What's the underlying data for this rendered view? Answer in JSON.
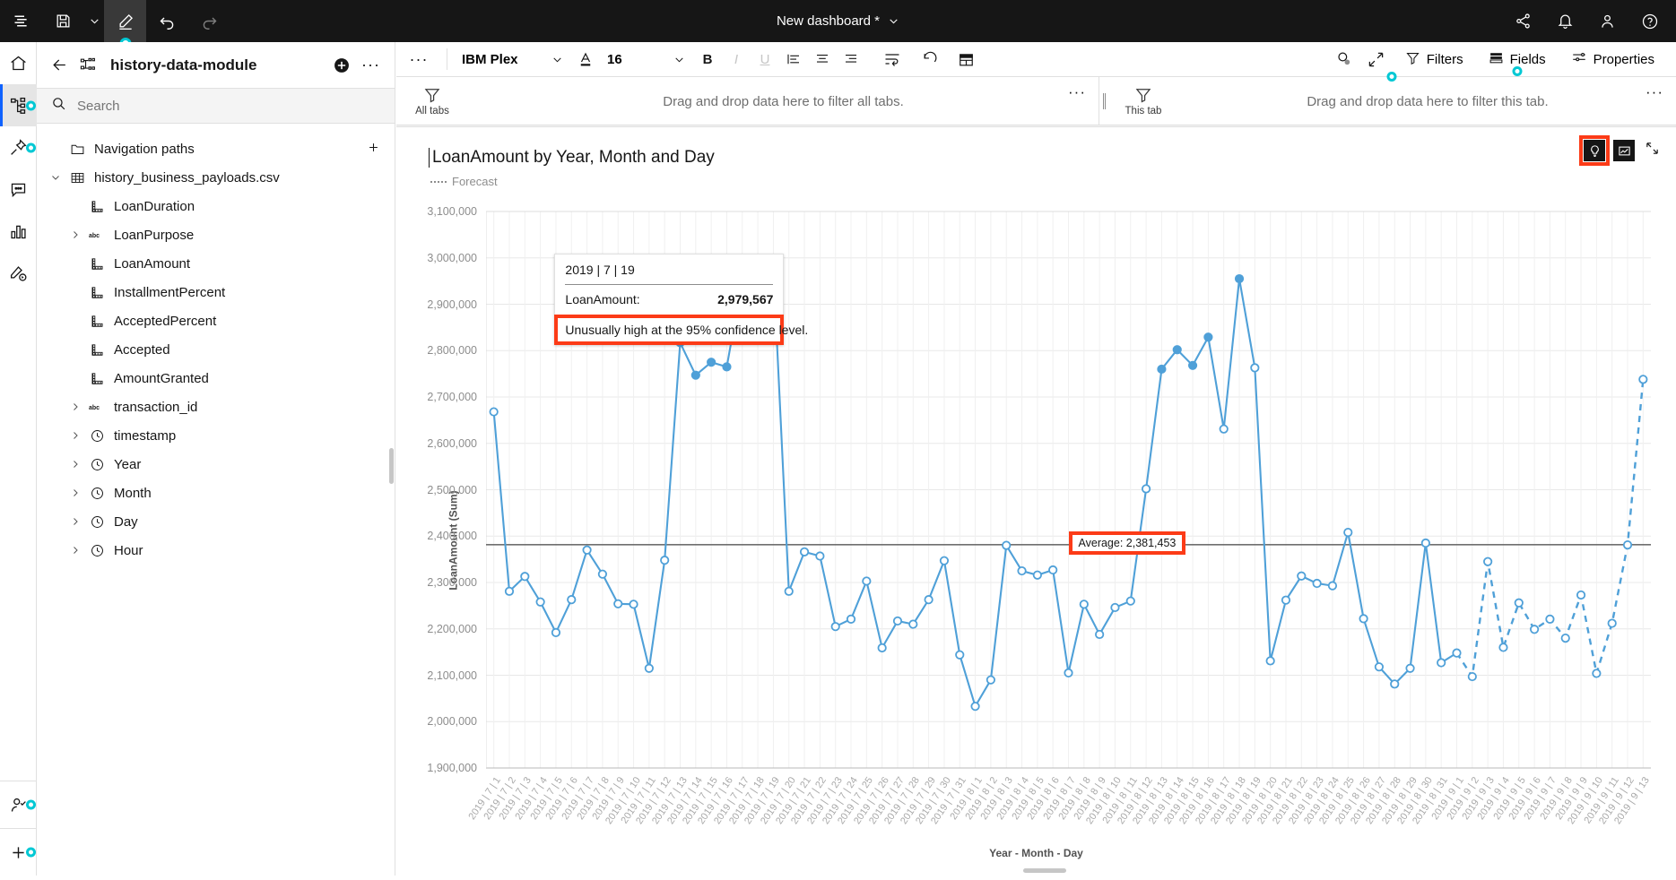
{
  "topbar": {
    "title": "New dashboard *",
    "left_icons": [
      {
        "name": "menu-list-icon",
        "label": "Show menu"
      },
      {
        "name": "save-icon",
        "label": "Save"
      },
      {
        "name": "save-caret-icon",
        "label": "Save options"
      },
      {
        "name": "edit-pencil-icon",
        "label": "Edit"
      },
      {
        "name": "undo-icon",
        "label": "Undo"
      },
      {
        "name": "redo-icon",
        "label": "Redo"
      }
    ],
    "right_icons": [
      {
        "name": "share-icon",
        "label": "Share"
      },
      {
        "name": "notification-bell-icon",
        "label": "Notifications"
      },
      {
        "name": "user-avatar-icon",
        "label": "Account"
      },
      {
        "name": "help-icon",
        "label": "Help"
      }
    ]
  },
  "rail": {
    "items": [
      {
        "name": "sidebar-item-home",
        "label": "Home",
        "dot": false
      },
      {
        "name": "sidebar-item-sources",
        "label": "Sources",
        "dot": true
      },
      {
        "name": "sidebar-item-pinned",
        "label": "Pinned",
        "dot": true
      },
      {
        "name": "sidebar-item-comments",
        "label": "Comments",
        "dot": false
      },
      {
        "name": "sidebar-item-visualizations",
        "label": "Visualizations",
        "dot": false
      },
      {
        "name": "sidebar-item-assistant",
        "label": "Assistant",
        "dot": false
      }
    ],
    "bottom": [
      {
        "name": "sidebar-item-user",
        "label": "User",
        "dot": true
      },
      {
        "name": "sidebar-item-add",
        "label": "Add",
        "dot": true
      }
    ]
  },
  "panel": {
    "title": "history-data-module",
    "add_label": "+",
    "overflow_label": "···",
    "search_placeholder": "Search",
    "search_value": "",
    "tree": [
      {
        "label": "Navigation paths",
        "icon": "folder-icon",
        "caret": "none",
        "indent": 1,
        "trailing": "plus-icon"
      },
      {
        "label": "history_business_payloads.csv",
        "icon": "table-icon",
        "caret": "down",
        "indent": 1
      },
      {
        "label": "LoanDuration",
        "icon": "measure-icon",
        "caret": "none",
        "indent": 2
      },
      {
        "label": "LoanPurpose",
        "icon": "abc-icon",
        "caret": "right",
        "indent": 2
      },
      {
        "label": "LoanAmount",
        "icon": "measure-icon",
        "caret": "none",
        "indent": 2
      },
      {
        "label": "InstallmentPercent",
        "icon": "measure-icon",
        "caret": "none",
        "indent": 2
      },
      {
        "label": "AcceptedPercent",
        "icon": "measure-icon",
        "caret": "none",
        "indent": 2
      },
      {
        "label": "Accepted",
        "icon": "measure-icon",
        "caret": "none",
        "indent": 2
      },
      {
        "label": "AmountGranted",
        "icon": "measure-icon",
        "caret": "none",
        "indent": 2
      },
      {
        "label": "transaction_id",
        "icon": "abc-icon",
        "caret": "right",
        "indent": 2
      },
      {
        "label": "timestamp",
        "icon": "clock-icon",
        "caret": "right",
        "indent": 2
      },
      {
        "label": "Year",
        "icon": "clock-icon",
        "caret": "right",
        "indent": 2
      },
      {
        "label": "Month",
        "icon": "clock-icon",
        "caret": "right",
        "indent": 2
      },
      {
        "label": "Day",
        "icon": "clock-icon",
        "caret": "right",
        "indent": 2
      },
      {
        "label": "Hour",
        "icon": "clock-icon",
        "caret": "right",
        "indent": 2
      }
    ]
  },
  "toolbar": {
    "more_label": "···",
    "font_name": "IBM Plex",
    "font_size": "16",
    "buttons": [
      {
        "name": "font-color-button",
        "label": "A"
      },
      {
        "name": "bold-button",
        "label": "B"
      },
      {
        "name": "italic-button",
        "label": "I"
      },
      {
        "name": "underline-button",
        "label": "U"
      }
    ],
    "right": [
      {
        "name": "tab-filters",
        "label": "Filters",
        "icon": "filter-icon",
        "active": false
      },
      {
        "name": "tab-fields",
        "label": "Fields",
        "icon": "fields-icon",
        "active": true
      },
      {
        "name": "tab-properties",
        "label": "Properties",
        "icon": "properties-icon",
        "active": false
      }
    ],
    "zoom_icon": "search-zoom-icon",
    "expand_icon": "expand-icon"
  },
  "filters": {
    "all_tabs": {
      "caption": "All tabs",
      "text": "Drag and drop data here to filter all tabs.",
      "more": "···"
    },
    "this_tab": {
      "caption": "This tab",
      "text": "Drag and drop data here to filter this tab.",
      "more": "···"
    }
  },
  "widget": {
    "title": "LoanAmount by Year, Month and Day",
    "legend": "Forecast",
    "actions": [
      {
        "name": "insights-lightbulb-button",
        "label": "Insights",
        "highlighted": true
      },
      {
        "name": "change-visualization-button",
        "label": "Change visualization",
        "highlighted": false
      }
    ],
    "collapse_icon": "collapse-arrows-icon"
  },
  "tooltip": {
    "header": "2019 | 7 | 19",
    "metric_label": "LoanAmount:",
    "metric_value": "2,979,567",
    "note": "Unusually high at the 95% confidence level."
  },
  "average_pill": "Average: 2,381,453",
  "chart_data": {
    "type": "line",
    "title": "LoanAmount by Year, Month and Day",
    "xlabel": "Year - Month - Day",
    "ylabel": "LoanAmount (Sum)",
    "ylim": [
      1900000,
      3100000
    ],
    "yticks": [
      3100000,
      3000000,
      2900000,
      2800000,
      2700000,
      2600000,
      2500000,
      2400000,
      2300000,
      2200000,
      2100000,
      2000000,
      1900000
    ],
    "ytick_labels": [
      "3,100,000",
      "3,000,000",
      "2,900,000",
      "2,800,000",
      "2,700,000",
      "2,600,000",
      "2,500,000",
      "2,400,000",
      "2,300,000",
      "2,200,000",
      "2,100,000",
      "2,000,000",
      "1,900,000"
    ],
    "grid": true,
    "legend": [
      "Forecast"
    ],
    "legend_position": "top-left",
    "average_line": 2381453,
    "average_label": "Average: 2,381,453",
    "highlight_point": {
      "x": "2019 | 7 | 19",
      "y": 2979567,
      "note": "Unusually high at the 95% confidence level."
    },
    "categories": [
      "2019 | 7 | 1",
      "2019 | 7 | 2",
      "2019 | 7 | 3",
      "2019 | 7 | 4",
      "2019 | 7 | 5",
      "2019 | 7 | 6",
      "2019 | 7 | 7",
      "2019 | 7 | 8",
      "2019 | 7 | 9",
      "2019 | 7 | 10",
      "2019 | 7 | 11",
      "2019 | 7 | 12",
      "2019 | 7 | 13",
      "2019 | 7 | 14",
      "2019 | 7 | 15",
      "2019 | 7 | 16",
      "2019 | 7 | 17",
      "2019 | 7 | 18",
      "2019 | 7 | 19",
      "2019 | 7 | 20",
      "2019 | 7 | 21",
      "2019 | 7 | 22",
      "2019 | 7 | 23",
      "2019 | 7 | 24",
      "2019 | 7 | 25",
      "2019 | 7 | 26",
      "2019 | 7 | 27",
      "2019 | 7 | 28",
      "2019 | 7 | 29",
      "2019 | 7 | 30",
      "2019 | 7 | 31",
      "2019 | 8 | 1",
      "2019 | 8 | 2",
      "2019 | 8 | 3",
      "2019 | 8 | 4",
      "2019 | 8 | 5",
      "2019 | 8 | 6",
      "2019 | 8 | 7",
      "2019 | 8 | 8",
      "2019 | 8 | 9",
      "2019 | 8 | 10",
      "2019 | 8 | 11",
      "2019 | 8 | 12",
      "2019 | 8 | 13",
      "2019 | 8 | 14",
      "2019 | 8 | 15",
      "2019 | 8 | 16",
      "2019 | 8 | 17",
      "2019 | 8 | 18",
      "2019 | 8 | 19",
      "2019 | 8 | 20",
      "2019 | 8 | 21",
      "2019 | 8 | 22",
      "2019 | 8 | 23",
      "2019 | 8 | 24",
      "2019 | 8 | 25",
      "2019 | 8 | 26",
      "2019 | 8 | 27",
      "2019 | 8 | 28",
      "2019 | 8 | 29",
      "2019 | 8 | 30",
      "2019 | 8 | 31",
      "2019 | 9 | 1",
      "2019 | 9 | 2",
      "2019 | 9 | 3",
      "2019 | 9 | 4",
      "2019 | 9 | 5",
      "2019 | 9 | 6",
      "2019 | 9 | 7",
      "2019 | 9 | 8",
      "2019 | 9 | 9",
      "2019 | 9 | 10",
      "2019 | 9 | 11",
      "2019 | 9 | 12",
      "2019 | 9 | 13"
    ],
    "series": [
      {
        "name": "LoanAmount (Sum)",
        "style": "solid",
        "color": "#4fa0d8",
        "values": [
          2668000,
          2281000,
          2313000,
          2258000,
          2192000,
          2263000,
          2370000,
          2318000,
          2254000,
          2253000,
          2115000,
          2348000,
          2817000,
          2747000,
          2775000,
          2765000,
          2952000,
          2958000,
          2979567,
          2281000,
          2366000,
          2357000,
          2205000,
          2221000,
          2303000,
          2159000,
          2217000,
          2210000,
          2263000,
          2347000,
          2144000,
          2033000,
          2090000,
          2380000,
          2325000,
          2316000,
          2327000,
          2105000,
          2253000,
          2188000,
          2246000,
          2260000,
          2502000,
          2760000,
          2802000,
          2768000,
          2829000,
          2631000,
          2955000,
          2763000,
          2131000,
          2262000,
          2314000,
          2298000,
          2293000,
          2408000,
          2222000,
          2118000,
          2081000,
          2115000,
          2385000,
          2127000,
          2148000
        ],
        "last_actual_index": 62
      },
      {
        "name": "Forecast",
        "style": "dashed",
        "color": "#4fa0d8",
        "start_index": 62,
        "values": [
          2148000,
          2097000,
          2345000,
          2160000,
          2256000,
          2199000,
          2221000,
          2180000,
          2273000,
          2104000,
          2212000,
          2381000,
          2738000
        ]
      }
    ]
  }
}
